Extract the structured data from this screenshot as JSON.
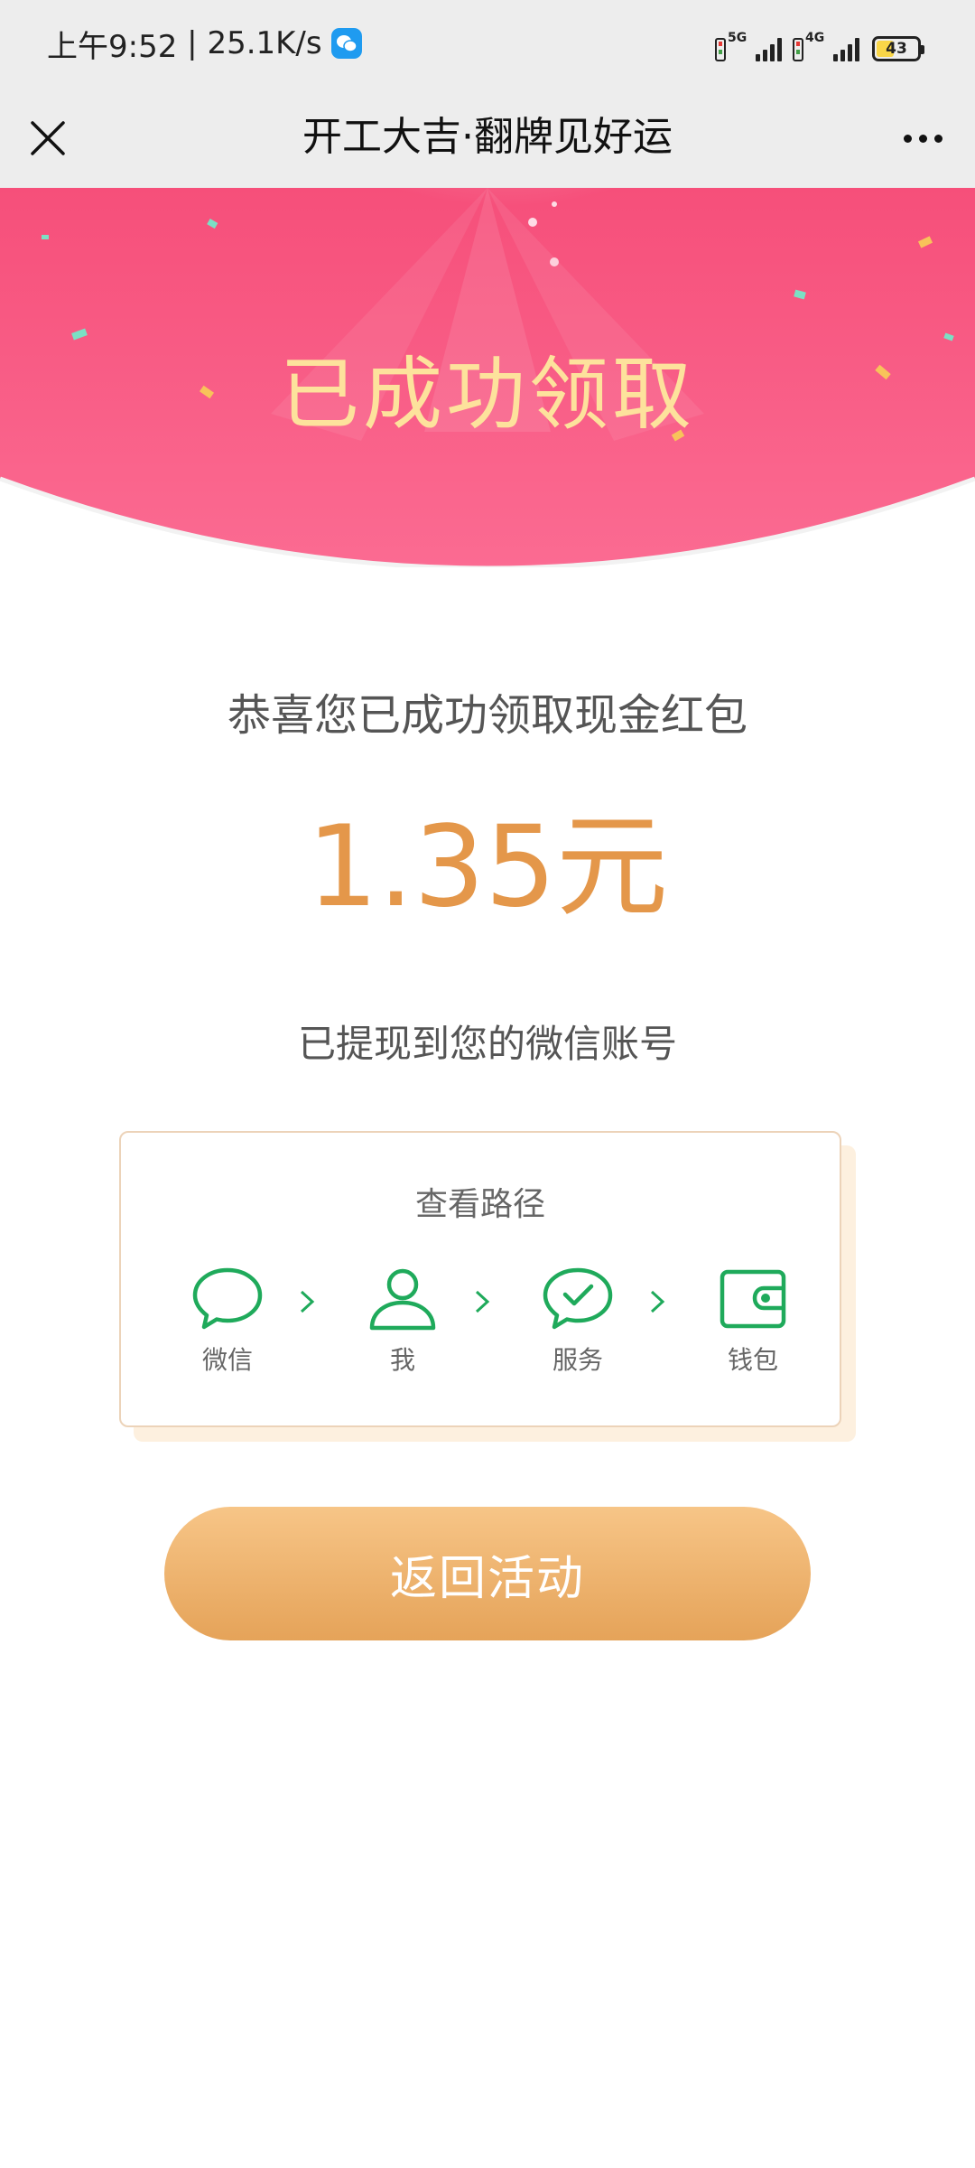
{
  "status_bar": {
    "time": "上午9:52",
    "net_speed": "25.1K/s",
    "signal_1_label": "5G",
    "signal_2_label": "4G",
    "battery_level": "43"
  },
  "title_bar": {
    "title": "开工大吉·翻牌见好运"
  },
  "banner": {
    "title": "已成功领取"
  },
  "main": {
    "congrats_text": "恭喜您已成功领取现金红包",
    "amount": "1.35元",
    "withdraw_note": "已提现到您的微信账号"
  },
  "path_card": {
    "title": "查看路径",
    "steps": [
      {
        "label": "微信",
        "icon": "chat-bubble-icon"
      },
      {
        "label": "我",
        "icon": "user-icon"
      },
      {
        "label": "服务",
        "icon": "check-bubble-icon"
      },
      {
        "label": "钱包",
        "icon": "wallet-icon"
      }
    ]
  },
  "actions": {
    "back_label": "返回活动"
  },
  "colors": {
    "banner_pink": "#f75d86",
    "gold_text": "#fde29c",
    "amount_orange": "#e4974a",
    "wechat_green": "#1aad19",
    "button_gradient_top": "#f7c587",
    "button_gradient_bottom": "#e5a359"
  }
}
